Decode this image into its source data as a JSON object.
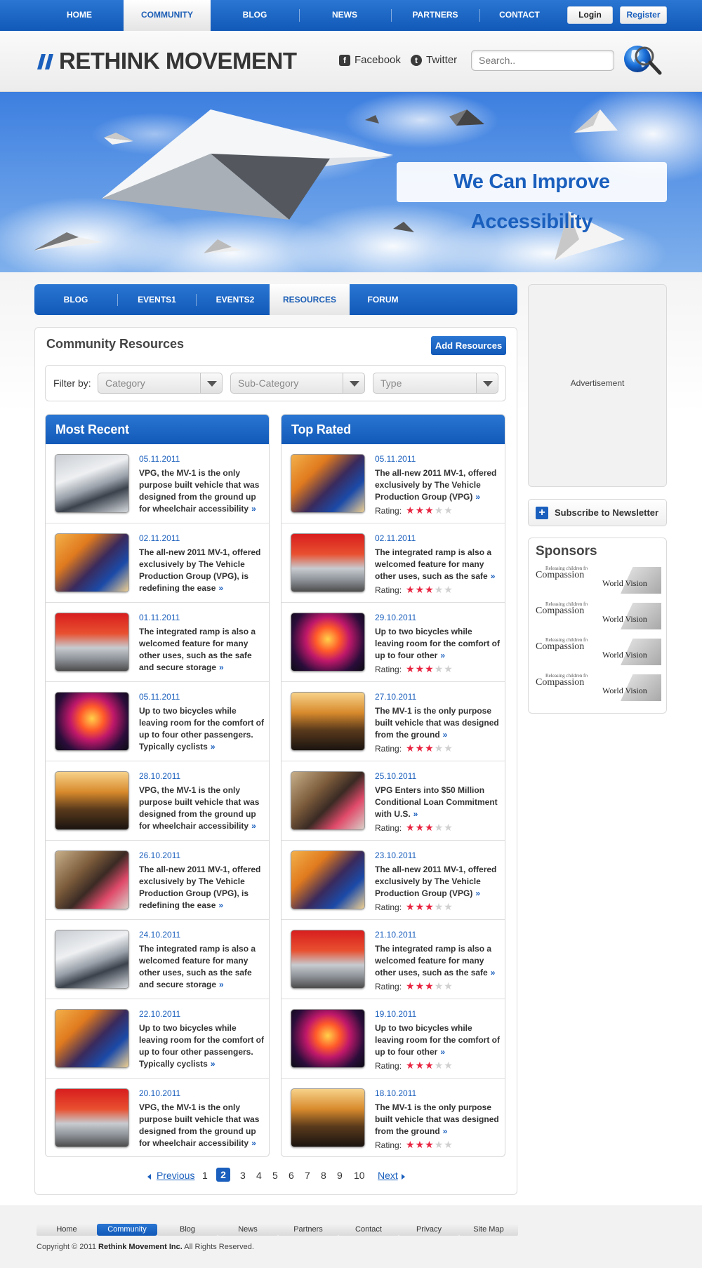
{
  "topnav": {
    "items": [
      {
        "label": "HOME"
      },
      {
        "label": "COMMUNITY",
        "active": true
      },
      {
        "label": "BLOG"
      },
      {
        "label": "NEWS"
      },
      {
        "label": "PARTNERS"
      },
      {
        "label": "CONTACT"
      }
    ],
    "login": "Login",
    "register": "Register"
  },
  "header": {
    "logo": "RETHINK MOVEMENT",
    "facebook": "Facebook",
    "twitter": "Twitter",
    "search_placeholder": "Search.."
  },
  "hero": {
    "title": "We Can Improve Accessibility"
  },
  "subnav": {
    "items": [
      {
        "label": "BLOG"
      },
      {
        "label": "EVENTS1"
      },
      {
        "label": "EVENTS2"
      },
      {
        "label": "RESOURCES",
        "active": true
      },
      {
        "label": "FORUM"
      }
    ]
  },
  "resources": {
    "title": "Community Resources",
    "add_button": "Add Resources",
    "filter_label": "Filter by:",
    "filters": [
      "Category",
      "Sub-Category",
      "Type"
    ]
  },
  "most_recent": {
    "heading": "Most Recent",
    "items": [
      {
        "date": "05.11.2011",
        "text": "VPG, the MV-1 is the only purpose built vehicle that was designed from the ground up for wheelchair accessibility",
        "thumb": "car-concept"
      },
      {
        "date": "02.11.2011",
        "text": "The all-new 2011 MV-1, offered exclusively by The Vehicle Production Group (VPG), is redefining the ease",
        "thumb": "cyclist"
      },
      {
        "date": "01.11.2011",
        "text": "The integrated ramp is also a welcomed feature for many other uses, such as the safe and secure storage",
        "thumb": "silver-car"
      },
      {
        "date": "05.11.2011",
        "text": "Up to two bicycles while leaving room for the comfort of up to four other passengers. Typically cyclists",
        "thumb": "ferris-wheel"
      },
      {
        "date": "28.10.2011",
        "text": "VPG, the MV-1 is the only purpose built vehicle that was designed from the ground up for wheelchair accessibility",
        "thumb": "car-interior"
      },
      {
        "date": "26.10.2011",
        "text": "The all-new 2011 MV-1, offered exclusively by The Vehicle Production Group (VPG), is redefining the ease",
        "thumb": "person-blur"
      },
      {
        "date": "24.10.2011",
        "text": "The integrated ramp is also a welcomed feature for many other uses, such as the safe and secure storage",
        "thumb": "car-concept"
      },
      {
        "date": "22.10.2011",
        "text": "Up to two bicycles while leaving room for the comfort of up to four other passengers. Typically cyclists",
        "thumb": "cyclist"
      },
      {
        "date": "20.10.2011",
        "text": "VPG, the MV-1 is the only purpose built vehicle that was designed from the ground up for wheelchair accessibility",
        "thumb": "silver-car"
      }
    ]
  },
  "top_rated": {
    "heading": "Top Rated",
    "rating_label": "Rating:",
    "items": [
      {
        "date": "05.11.2011",
        "text": "The all-new 2011 MV-1, offered exclusively by The Vehicle Production Group (VPG)",
        "rating": 3,
        "thumb": "cyclist"
      },
      {
        "date": "02.11.2011",
        "text": "The integrated ramp is also a welcomed feature for many other uses, such as the safe",
        "rating": 3,
        "thumb": "silver-car"
      },
      {
        "date": "29.10.2011",
        "text": "Up to two bicycles while leaving room for the comfort of up to four other",
        "rating": 3,
        "thumb": "ferris-wheel"
      },
      {
        "date": "27.10.2011",
        "text": "The MV-1 is the only purpose built vehicle that was designed from the ground",
        "rating": 3,
        "thumb": "car-interior"
      },
      {
        "date": "25.10.2011",
        "text": "VPG Enters into $50 Million Conditional Loan Commitment with U.S.",
        "rating": 3,
        "thumb": "person-blur"
      },
      {
        "date": "23.10.2011",
        "text": "The all-new 2011 MV-1, offered exclusively by The Vehicle Production Group (VPG)",
        "rating": 3,
        "thumb": "cyclist"
      },
      {
        "date": "21.10.2011",
        "text": "The integrated ramp is also a welcomed feature for many other uses, such as the safe",
        "rating": 3,
        "thumb": "silver-car"
      },
      {
        "date": "19.10.2011",
        "text": "Up to two bicycles while leaving room for the comfort of up to four other",
        "rating": 3,
        "thumb": "ferris-wheel"
      },
      {
        "date": "18.10.2011",
        "text": "The MV-1 is the only purpose built vehicle that was designed from the ground",
        "rating": 3,
        "thumb": "car-interior"
      }
    ]
  },
  "pagination": {
    "previous": "Previous",
    "next": "Next",
    "pages": [
      "1",
      "2",
      "3",
      "4",
      "5",
      "6",
      "7",
      "8",
      "9",
      "10"
    ],
    "current": "2"
  },
  "sidebar": {
    "ad_label": "Advertisement",
    "newsletter": "Subscribe to Newsletter",
    "sponsors_title": "Sponsors",
    "sponsors": [
      {
        "left": "Compassion",
        "left_small": "Releasing children from poverty in Jesus' name",
        "right": "World Vision"
      },
      {
        "left": "Compassion",
        "left_small": "Releasing children from poverty in Jesus' name",
        "right": "World Vision"
      },
      {
        "left": "Compassion",
        "left_small": "Releasing children from poverty in Jesus' name",
        "right": "World Vision"
      },
      {
        "left": "Compassion",
        "left_small": "Releasing children from poverty in Jesus' name",
        "right": "World Vision"
      }
    ]
  },
  "footer": {
    "items": [
      {
        "label": "Home"
      },
      {
        "label": "Community",
        "active": true
      },
      {
        "label": "Blog"
      },
      {
        "label": "News"
      },
      {
        "label": "Partners"
      },
      {
        "label": "Contact"
      },
      {
        "label": "Privacy"
      },
      {
        "label": "Site Map"
      }
    ],
    "copyright_prefix": "Copyright © 2011",
    "copyright_company": "Rethink Movement Inc.",
    "copyright_suffix": "All Rights Reserved."
  },
  "colors": {
    "brand_blue": "#1a5fbd",
    "star_red": "#e8233f"
  }
}
